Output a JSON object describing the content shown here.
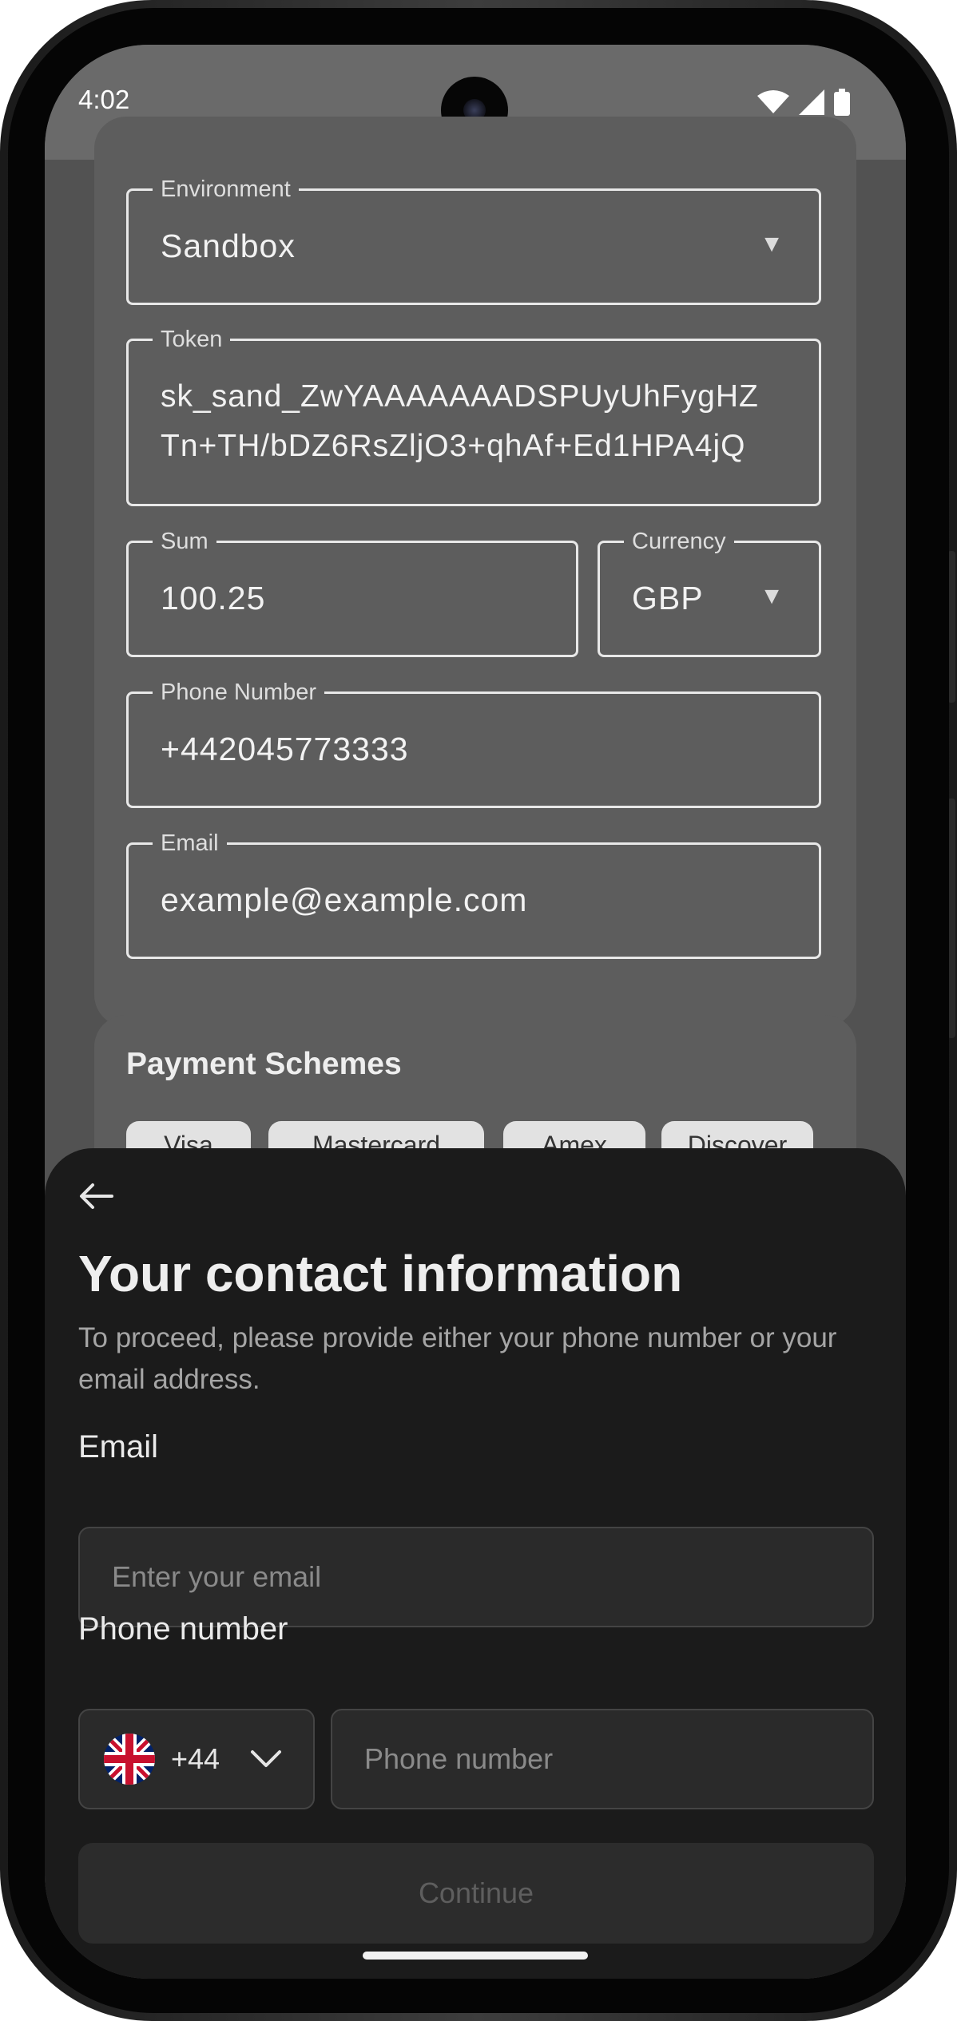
{
  "status_bar": {
    "time": "4:02"
  },
  "settings": {
    "environment": {
      "label": "Environment",
      "value": "Sandbox"
    },
    "token": {
      "label": "Token",
      "line1": "sk_sand_ZwYAAAAAAADSPUyUhFygHZ",
      "line2": "Tn+TH/bDZ6RsZljO3+qhAf+Ed1HPA4jQ"
    },
    "sum": {
      "label": "Sum",
      "value": "100.25"
    },
    "currency": {
      "label": "Currency",
      "value": "GBP"
    },
    "phone": {
      "label": "Phone Number",
      "value": "+442045773333"
    },
    "email": {
      "label": "Email",
      "value": "example@example.com"
    }
  },
  "payment_schemes": {
    "title": "Payment Schemes",
    "chips": [
      "Visa",
      "Mastercard",
      "Amex",
      "Discover"
    ]
  },
  "contact_sheet": {
    "title": "Your contact information",
    "description": "To proceed, please provide either your phone number or your email address.",
    "email_label": "Email",
    "email_placeholder": "Enter your email",
    "phone_label": "Phone number",
    "country_code": "+44",
    "phone_placeholder": "Phone number",
    "continue_label": "Continue"
  },
  "colors": {
    "sheet_background": "#1b1b1b",
    "card_background": "#5d5d5d",
    "screen_background": "#525252"
  }
}
